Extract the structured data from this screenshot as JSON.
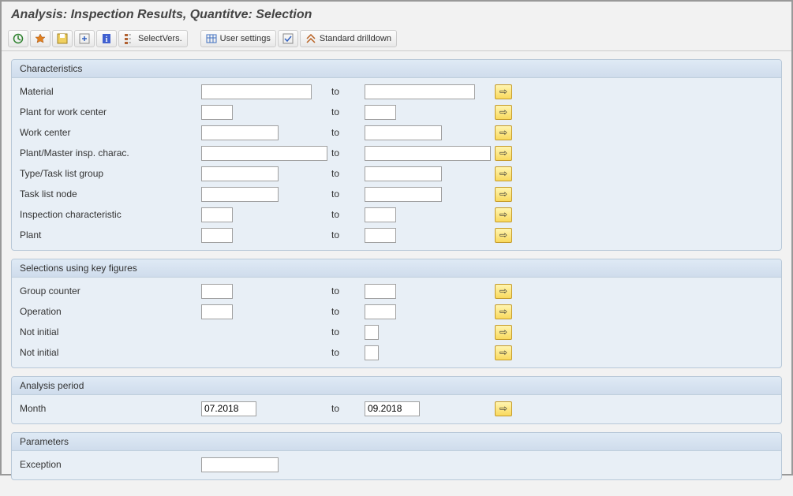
{
  "title": "Analysis: Inspection Results, Quantitve: Selection",
  "toolbar": {
    "execute": "",
    "variant": "",
    "save": "",
    "plus": "",
    "info": "",
    "select_vers": "SelectVers.",
    "user_settings": "User settings",
    "std_drill": "Standard drilldown"
  },
  "groups": {
    "characteristics": {
      "title": "Characteristics",
      "rows": [
        {
          "label": "Material",
          "w": "w-full"
        },
        {
          "label": "Plant for work center",
          "w": "w-sm"
        },
        {
          "label": "Work center",
          "w": "w-md"
        },
        {
          "label": "Plant/Master insp. charac.",
          "w": "w-mf"
        },
        {
          "label": "Type/Task list group",
          "w": "w-md"
        },
        {
          "label": "Task list node",
          "w": "w-md"
        },
        {
          "label": "Inspection characteristic",
          "w": "w-sm"
        },
        {
          "label": "Plant",
          "w": "w-sm"
        }
      ]
    },
    "keyfigures": {
      "title": "Selections using key figures",
      "rows": [
        {
          "label": "Group counter",
          "w": "w-sm"
        },
        {
          "label": "Operation",
          "w": "w-sm"
        },
        {
          "label": "Not initial",
          "w": ""
        },
        {
          "label": "Not initial",
          "w": ""
        }
      ]
    },
    "period": {
      "title": "Analysis period",
      "label": "Month",
      "from": "07.2018",
      "to_label": "to",
      "to": "09.2018"
    },
    "parameters": {
      "title": "Parameters",
      "label": "Exception"
    }
  },
  "to_label": "to"
}
